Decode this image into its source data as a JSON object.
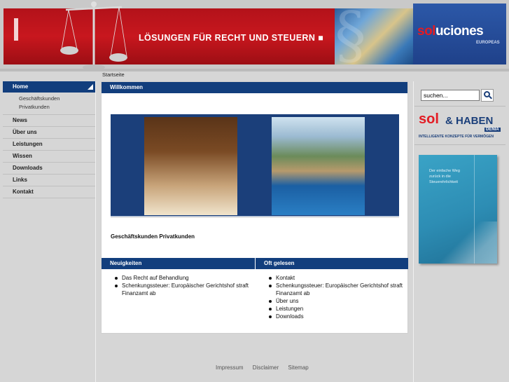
{
  "header": {
    "slogan": "LÖSUNGEN FÜR RECHT UND STEUERN ■",
    "logo_word_sol": "sol",
    "logo_word_rest": "uciones",
    "logo_sub": "EUROPEAS",
    "brand_red": "#c8171e",
    "brand_blue": "#123e7d"
  },
  "breadcrumb": "Startseite",
  "nav": {
    "home": "Home",
    "sub": [
      "Geschäftskunden",
      "Privatkunden"
    ],
    "items": [
      "News",
      "Über uns",
      "Leistungen",
      "Wissen",
      "Downloads",
      "Links",
      "Kontakt"
    ]
  },
  "main": {
    "welcome_title": "Willkommen",
    "category_links": "Geschäftskunden Privatkunden",
    "news": {
      "title": "Neuigkeiten",
      "items": [
        "Das Recht auf Behandlung",
        "Schenkungssteuer: Europäischer Gerichtshof straft Finanzamt ab"
      ]
    },
    "popular": {
      "title": "Oft gelesen",
      "items": [
        "Kontakt",
        "Schenkungssteuer: Europäischer Gerichtshof straft Finanzamt ab",
        "Über uns",
        "Leistungen",
        "Downloads"
      ]
    }
  },
  "sidebar": {
    "search_value": "suchen...",
    "promo_sol": "sol",
    "promo_haben": "& HABEN",
    "promo_denia": "DENIA",
    "promo_tagline": "INTELLIGENTE KONZEPTE FÜR VERMÖGEN",
    "book_text": "Der einfache Weg zurück in die Steuerehrlichkeit"
  },
  "footer": {
    "links": [
      "Impressum",
      "Disclaimer",
      "Sitemap"
    ]
  }
}
